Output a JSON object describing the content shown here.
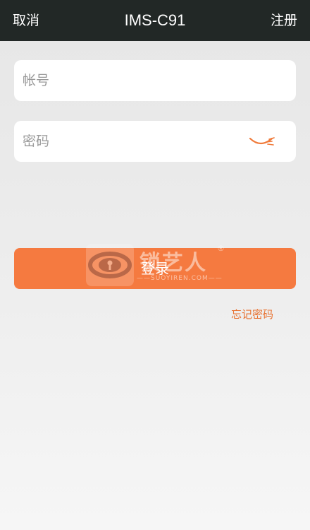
{
  "header": {
    "cancel_label": "取消",
    "title": "IMS-C91",
    "register_label": "注册"
  },
  "form": {
    "account_placeholder": "帐号",
    "account_value": "",
    "password_placeholder": "密码",
    "password_value": "",
    "password_toggle_icon": "eye-closed-icon",
    "login_label": "登录",
    "forgot_label": "忘记密码"
  },
  "watermark": {
    "brand": "锁艺人",
    "registered": "®",
    "domain": "——SUOYIREN.COM——"
  },
  "colors": {
    "topbar": "#222826",
    "accent": "#f57a40",
    "link": "#e8702e",
    "field_bg": "#ffffff"
  }
}
